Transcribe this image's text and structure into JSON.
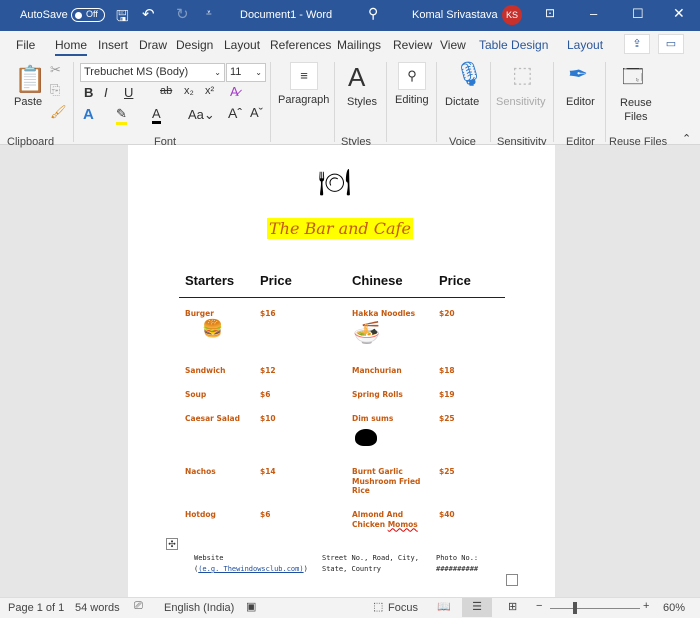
{
  "titlebar": {
    "autosave": "AutoSave",
    "toggle": "Off",
    "doc_title": "Document1  -  Word",
    "user": "Komal Srivastava",
    "initials": "KS"
  },
  "tabs": [
    "File",
    "Home",
    "Insert",
    "Draw",
    "Design",
    "Layout",
    "References",
    "Mailings",
    "Review",
    "View",
    "Table Design",
    "Layout"
  ],
  "ribbon": {
    "font_name": "Trebuchet MS (Body)",
    "font_size": "11",
    "paste": "Paste",
    "paragraph": "Paragraph",
    "styles": "Styles",
    "editing": "Editing",
    "dictate": "Dictate",
    "sensitivity": "Sensitivity",
    "editor": "Editor",
    "reuse1": "Reuse",
    "reuse2": "Files",
    "groups": {
      "clipboard": "Clipboard",
      "font": "Font",
      "styles": "Styles",
      "voice": "Voice",
      "sensitivity": "Sensitivity",
      "editor": "Editor",
      "reuse": "Reuse Files"
    }
  },
  "doc": {
    "title": "The Bar and Cafe",
    "headers": [
      "Starters",
      "Price",
      "Chinese",
      "Price"
    ],
    "left": [
      {
        "name": "Burger",
        "price": "$16"
      },
      {
        "name": "Sandwich",
        "price": "$12"
      },
      {
        "name": "Soup",
        "price": "$6"
      },
      {
        "name": "Caesar Salad",
        "price": "$10"
      },
      {
        "name": "Nachos",
        "price": "$14"
      },
      {
        "name": "Hotdog",
        "price": "$6"
      }
    ],
    "right": [
      {
        "name": "Hakka Noodles",
        "price": "$20"
      },
      {
        "name": "Manchurian",
        "price": "$18"
      },
      {
        "name": "Spring Rolls",
        "price": "$19"
      },
      {
        "name": "Dim sums",
        "price": "$25"
      },
      {
        "name": "Burnt Garlic",
        "name2": "Mushroom Fried",
        "name3": "Rice",
        "price": "$25"
      },
      {
        "name": "Almond And",
        "name2": "Chicken",
        "name3": "Momos",
        "price": "$40"
      }
    ],
    "footer": {
      "website": "Website",
      "website2": "(e.g. Thewindowsclub.com)",
      "address": "Street No., Road, City,",
      "address2": "State, Country",
      "phone": "Photo No.:",
      "phone2": "##########"
    }
  },
  "status": {
    "page": "Page 1 of 1",
    "words": "54 words",
    "language": "English (India)",
    "focus": "Focus",
    "zoom": "60%",
    "zoom_level": 0.6
  }
}
